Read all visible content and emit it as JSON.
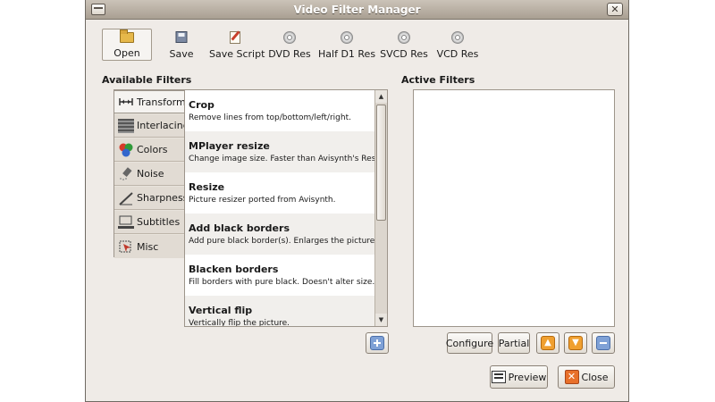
{
  "window": {
    "title": "Video Filter Manager",
    "close_glyph": "✕"
  },
  "toolbar": {
    "open": {
      "label": "Open",
      "icon": "folder-open-icon"
    },
    "save": {
      "label": "Save",
      "icon": "floppy-icon"
    },
    "save_script": {
      "label": "Save Script",
      "icon": "script-icon"
    },
    "dvd": {
      "label": "DVD Res",
      "icon": "cd-icon"
    },
    "half_d1": {
      "label": "Half D1 Res",
      "icon": "cd-icon"
    },
    "svcd": {
      "label": "SVCD Res",
      "icon": "cd-icon"
    },
    "vcd": {
      "label": "VCD Res",
      "icon": "cd-icon"
    }
  },
  "available_filters": {
    "heading": "Available Filters",
    "tabs": [
      {
        "label": "Transform",
        "icon": "transform-icon",
        "active": true
      },
      {
        "label": "Interlacing",
        "icon": "interlacing-icon"
      },
      {
        "label": "Colors",
        "icon": "colors-icon"
      },
      {
        "label": "Noise",
        "icon": "noise-icon"
      },
      {
        "label": "Sharpness",
        "icon": "sharpness-icon"
      },
      {
        "label": "Subtitles",
        "icon": "subtitles-icon"
      },
      {
        "label": "Misc",
        "icon": "misc-icon"
      }
    ],
    "items": [
      {
        "name": "Crop",
        "description": "Remove lines from top/bottom/left/right."
      },
      {
        "name": "MPlayer resize",
        "description": "Change image size. Faster than Avisynth's Resize."
      },
      {
        "name": "Resize",
        "description": "Picture resizer ported from Avisynth."
      },
      {
        "name": "Add black borders",
        "description": "Add pure black border(s). Enlarges the picture."
      },
      {
        "name": "Blacken borders",
        "description": "Fill borders with pure black. Doesn't alter size."
      },
      {
        "name": "Vertical flip",
        "description": "Vertically flip the picture."
      }
    ]
  },
  "active_filters": {
    "heading": "Active Filters"
  },
  "buttons": {
    "configure": "Configure",
    "partial": "Partial",
    "preview": "Preview",
    "close": "Close"
  },
  "colors": {
    "accent_orange": "#f0a030",
    "accent_blue": "#7fa1d6",
    "close_red": "#e8702a"
  }
}
